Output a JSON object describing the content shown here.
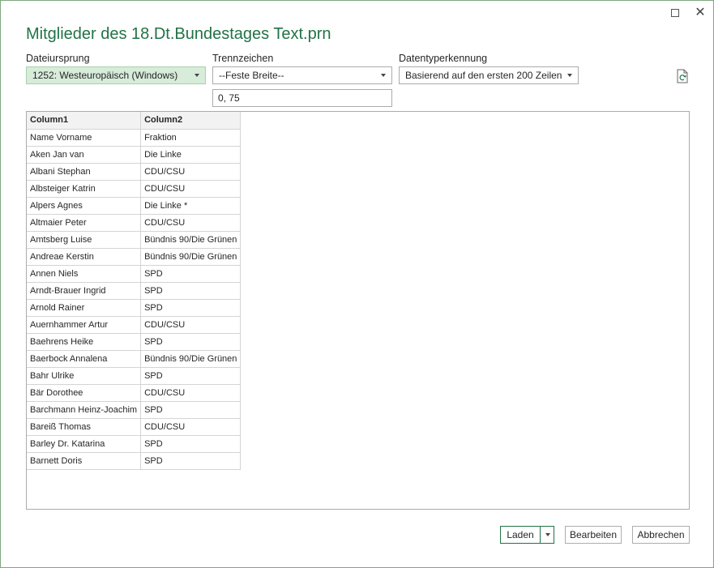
{
  "window": {
    "title": "Mitglieder des 18.Dt.Bundestages Text.prn",
    "maximize_icon": "maximize-icon",
    "close_icon": "close-icon",
    "close_glyph": "✕"
  },
  "options": {
    "file_origin": {
      "label": "Dateiursprung",
      "value": "1252: Westeuropäisch (Windows)"
    },
    "delimiter": {
      "label": "Trennzeichen",
      "value": "--Feste Breite--",
      "positions": "0, 75"
    },
    "type_detection": {
      "label": "Datentyperkennung",
      "value": "Basierend auf den ersten 200 Zeilen"
    }
  },
  "table": {
    "headers": [
      "Column1",
      "Column2"
    ],
    "rows": [
      [
        "Name Vorname",
        "Fraktion"
      ],
      [
        "Aken Jan van",
        "Die Linke"
      ],
      [
        "Albani Stephan",
        "CDU/CSU"
      ],
      [
        "Albsteiger Katrin",
        "CDU/CSU"
      ],
      [
        "Alpers Agnes",
        "Die Linke *"
      ],
      [
        "Altmaier Peter",
        "CDU/CSU"
      ],
      [
        "Amtsberg Luise",
        "Bündnis 90/Die Grünen"
      ],
      [
        "Andreae Kerstin",
        "Bündnis 90/Die Grünen"
      ],
      [
        "Annen Niels",
        "SPD"
      ],
      [
        "Arndt-Brauer Ingrid",
        "SPD"
      ],
      [
        "Arnold Rainer",
        "SPD"
      ],
      [
        "Auernhammer Artur",
        "CDU/CSU"
      ],
      [
        "Baehrens Heike",
        "SPD"
      ],
      [
        "Baerbock Annalena",
        "Bündnis 90/Die Grünen"
      ],
      [
        "Bahr Ulrike",
        "SPD"
      ],
      [
        "Bär Dorothee",
        "CDU/CSU"
      ],
      [
        "Barchmann Heinz-Joachim",
        "SPD"
      ],
      [
        "Bareiß Thomas",
        "CDU/CSU"
      ],
      [
        "Barley Dr. Katarina",
        "SPD"
      ],
      [
        "Barnett Doris",
        "SPD"
      ]
    ]
  },
  "buttons": {
    "load": "Laden",
    "edit": "Bearbeiten",
    "cancel": "Abbrechen"
  },
  "colors": {
    "accent": "#217346",
    "selected_bg": "#d7ecd9"
  }
}
